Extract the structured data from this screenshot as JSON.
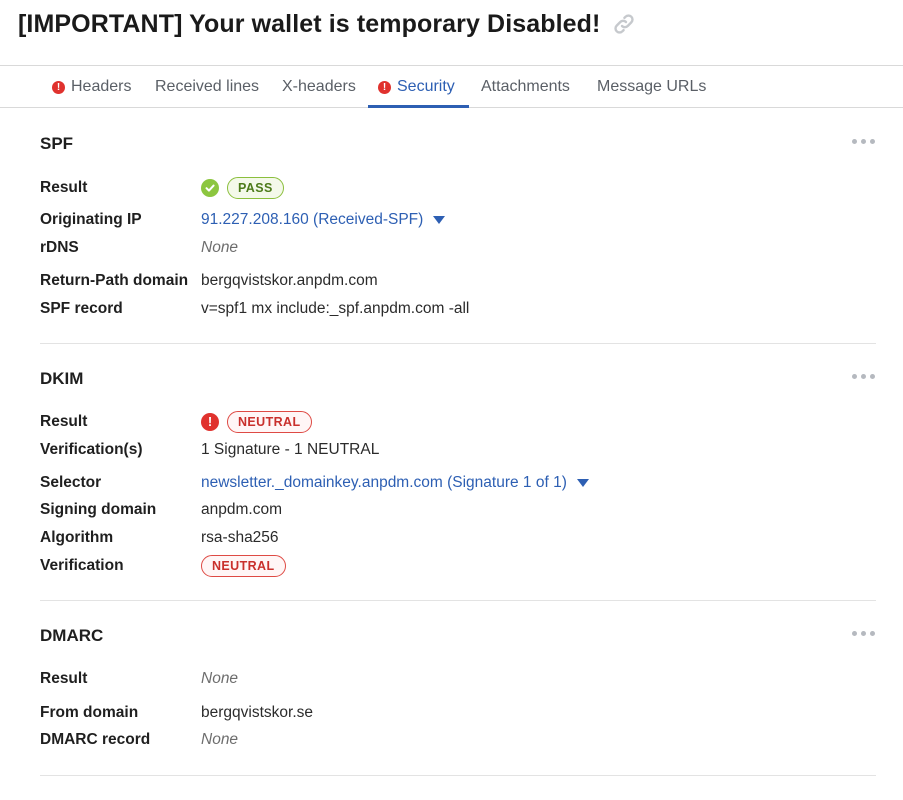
{
  "email": {
    "subject": "[IMPORTANT] Your wallet is temporary Disabled!",
    "link_icon": "link-icon"
  },
  "tabs": [
    {
      "label": "Headers",
      "warning": true,
      "active": false
    },
    {
      "label": "Received lines",
      "warning": false,
      "active": false
    },
    {
      "label": "X-headers",
      "warning": false,
      "active": false
    },
    {
      "label": "Security",
      "warning": true,
      "active": true
    },
    {
      "label": "Attachments",
      "warning": false,
      "active": false
    },
    {
      "label": "Message URLs",
      "warning": false,
      "active": false
    }
  ],
  "colors": {
    "accent": "#2d5fb3",
    "pass": "#8cc63f",
    "fail": "#e0322e"
  },
  "spf": {
    "title": "SPF",
    "result_label": "Result",
    "result_badge": "PASS",
    "result_icon": "check-circle-icon",
    "originating_ip_label": "Originating IP",
    "originating_ip_value": "91.227.208.160 (Received-SPF)",
    "rdns_label": "rDNS",
    "rdns_value": "None",
    "return_path_label": "Return-Path domain",
    "return_path_value": "bergqvistskor.anpdm.com",
    "spf_record_label": "SPF record",
    "spf_record_value": "v=spf1 mx include:_spf.anpdm.com -all"
  },
  "dkim": {
    "title": "DKIM",
    "result_label": "Result",
    "result_badge": "NEUTRAL",
    "result_icon": "error-circle-icon",
    "verifications_label": "Verification(s)",
    "verifications_value": "1 Signature - 1 NEUTRAL",
    "selector_label": "Selector",
    "selector_value": "newsletter._domainkey.anpdm.com (Signature 1 of 1)",
    "signing_domain_label": "Signing domain",
    "signing_domain_value": "anpdm.com",
    "algorithm_label": "Algorithm",
    "algorithm_value": "rsa-sha256",
    "verification_label": "Verification",
    "verification_badge": "NEUTRAL"
  },
  "dmarc": {
    "title": "DMARC",
    "result_label": "Result",
    "result_value": "None",
    "from_domain_label": "From domain",
    "from_domain_value": "bergqvistskor.se",
    "dmarc_record_label": "DMARC record",
    "dmarc_record_value": "None"
  }
}
